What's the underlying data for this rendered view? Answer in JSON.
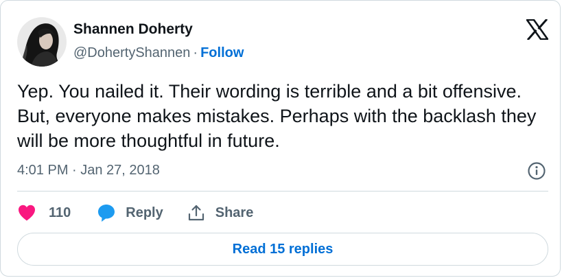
{
  "author": {
    "name": "Shannen Doherty",
    "handle": "@DohertyShannen",
    "separator": "·",
    "follow_label": "Follow",
    "avatar_icon": "profile-photo"
  },
  "brand": {
    "logo_icon": "x-logo"
  },
  "tweet": {
    "text": "Yep. You nailed it. Their wording is terrible and a bit offensive. But, everyone makes mistakes. Perhaps with the backlash they will be more thoughtful in future.",
    "timestamp": "4:01 PM · Jan 27, 2018",
    "info_icon": "info-icon"
  },
  "actions": {
    "like_count": "110",
    "reply_label": "Reply",
    "share_label": "Share"
  },
  "read_replies_label": "Read 15 replies",
  "colors": {
    "heart": "#f91880",
    "reply_bubble": "#1d9bf0",
    "link": "#006fd6",
    "secondary_text": "#536471",
    "border": "#cfd9de"
  }
}
